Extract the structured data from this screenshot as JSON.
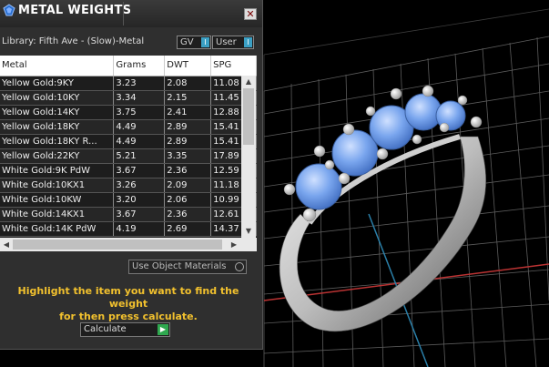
{
  "panel": {
    "title": "METAL WEIGHTS",
    "close_label": "✕",
    "library_label": "Library: Fifth Ave - (Slow)-Metal",
    "gv_label": "GV",
    "user_label": "User",
    "toggle_knob": "I"
  },
  "table": {
    "columns": [
      "Metal",
      "Grams",
      "DWT",
      "SPG"
    ],
    "rows": [
      [
        "Yellow Gold:9KY",
        "3.23",
        "2.08",
        "11.08"
      ],
      [
        "Yellow Gold:10KY",
        "3.34",
        "2.15",
        "11.45"
      ],
      [
        "Yellow Gold:14KY",
        "3.75",
        "2.41",
        "12.88"
      ],
      [
        "Yellow Gold:18KY",
        "4.49",
        "2.89",
        "15.41"
      ],
      [
        "Yellow Gold:18KY R...",
        "4.49",
        "2.89",
        "15.41"
      ],
      [
        "Yellow Gold:22KY",
        "5.21",
        "3.35",
        "17.89"
      ],
      [
        "White Gold:9K PdW",
        "3.67",
        "2.36",
        "12.59"
      ],
      [
        "White Gold:10KX1",
        "3.26",
        "2.09",
        "11.18"
      ],
      [
        "White Gold:10KW",
        "3.20",
        "2.06",
        "10.99"
      ],
      [
        "White Gold:14KX1",
        "3.67",
        "2.36",
        "12.61"
      ],
      [
        "White Gold:14K PdW",
        "4.19",
        "2.69",
        "14.37"
      ]
    ]
  },
  "options": {
    "use_object_materials": "Use Object Materials"
  },
  "instructions": {
    "line1": "Highlight the item you want to find the weight",
    "line2": "for then press calculate."
  },
  "calculate": {
    "label": "Calculate",
    "arrow": "▶"
  },
  "colors": {
    "accent": "#f2c12e",
    "stone": "#6f9de8",
    "grid": "#6a6a6a"
  }
}
